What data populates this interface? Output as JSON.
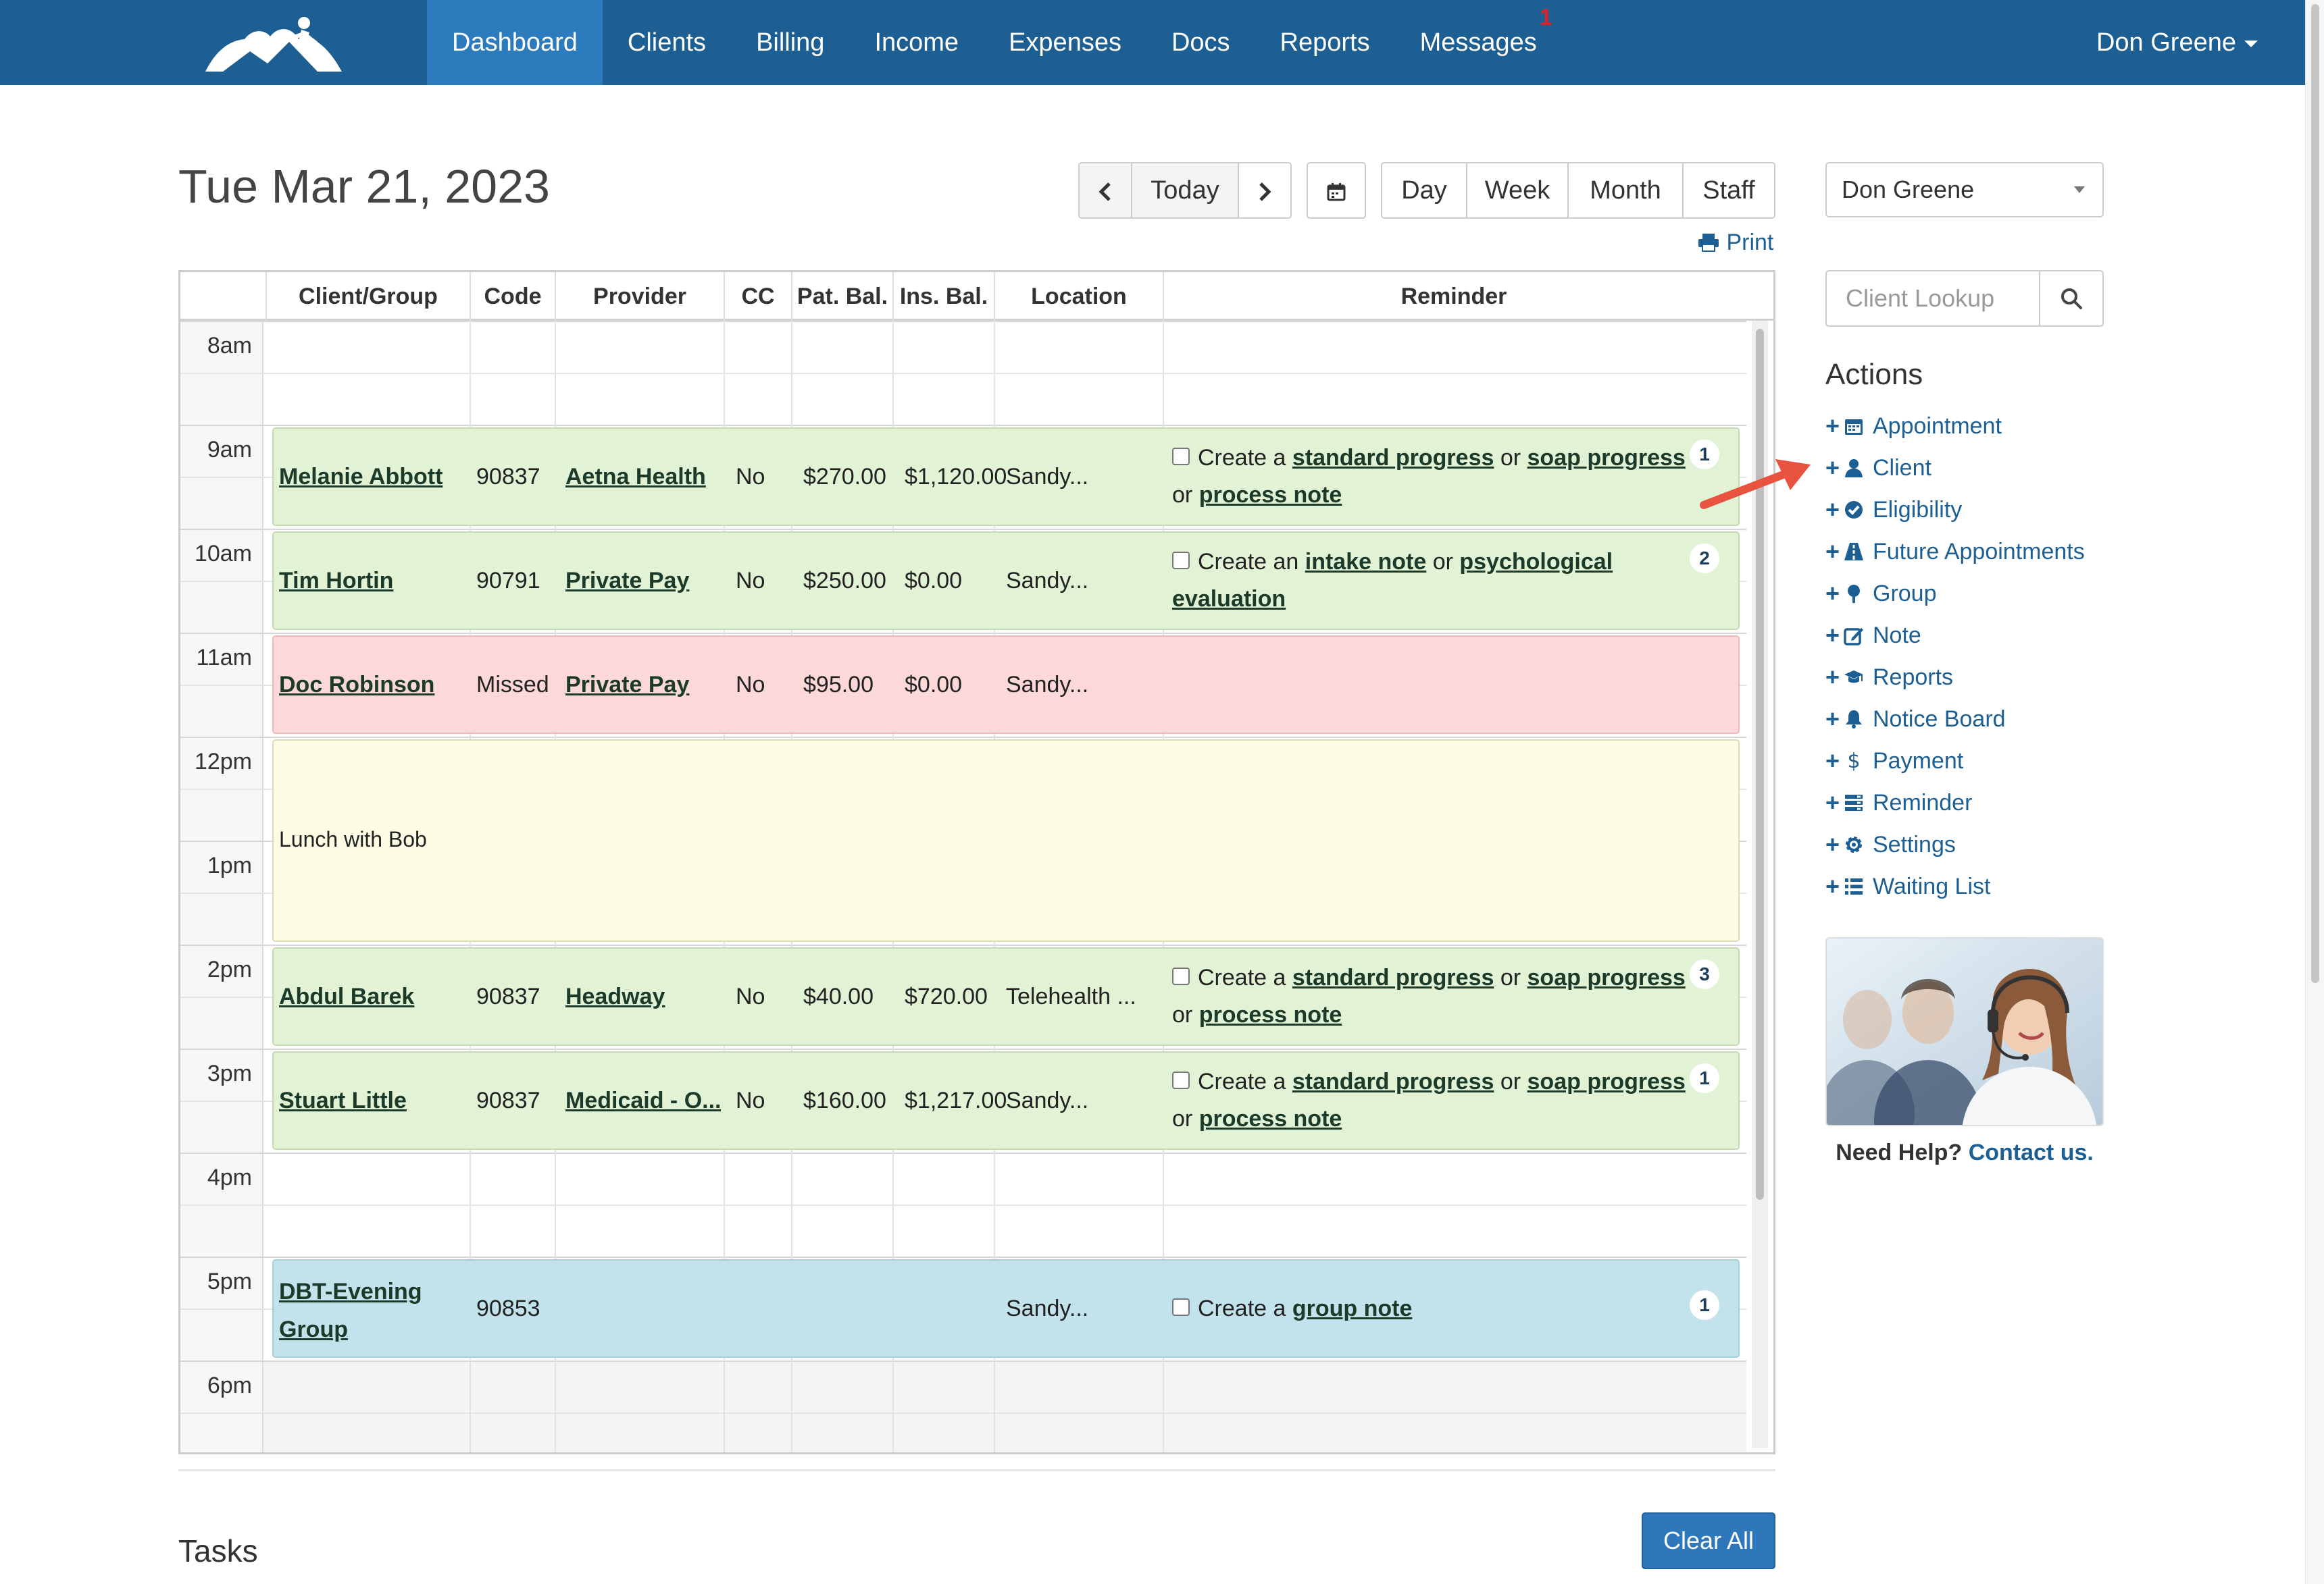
{
  "nav": {
    "items": [
      "Dashboard",
      "Clients",
      "Billing",
      "Income",
      "Expenses",
      "Docs",
      "Reports",
      "Messages"
    ],
    "messages_badge": "1",
    "user": "Don Greene"
  },
  "header": {
    "date": "Tue Mar 21, 2023",
    "today": "Today",
    "views": [
      "Day",
      "Week",
      "Month",
      "Staff"
    ],
    "print": "Print"
  },
  "table": {
    "columns": [
      "Client/Group",
      "Code",
      "Provider",
      "CC",
      "Pat. Bal.",
      "Ins. Bal.",
      "Location",
      "Reminder"
    ],
    "times": [
      "8am",
      "9am",
      "10am",
      "11am",
      "12pm",
      "1pm",
      "2pm",
      "3pm",
      "4pm",
      "5pm",
      "6pm"
    ],
    "appointments": [
      {
        "client": "Melanie Abbott",
        "code": "90837",
        "provider": "Aetna Health",
        "cc": "No",
        "pat": "$270.00",
        "ins": "$1,120.00",
        "location": "Sandy...",
        "r1": "Create a ",
        "l1": "standard progress",
        "r2": " or ",
        "l2": "soap progress",
        "r3": " or ",
        "l3": "process note",
        "badge": "1"
      },
      {
        "client": "Tim Hortin",
        "code": "90791",
        "provider": "Private Pay",
        "cc": "No",
        "pat": "$250.00",
        "ins": "$0.00",
        "location": "Sandy...",
        "r1": "Create an ",
        "l1": "intake note",
        "r2": " or ",
        "l2": "psychological evaluation",
        "badge": "2"
      },
      {
        "client": "Doc Robinson",
        "code": "Missed",
        "provider": "Private Pay",
        "cc": "No",
        "pat": "$95.00",
        "ins": "$0.00",
        "location": "Sandy..."
      },
      {
        "client": "Abdul Barek",
        "code": "90837",
        "provider": "Headway",
        "cc": "No",
        "pat": "$40.00",
        "ins": "$720.00",
        "location": "Telehealth ...",
        "r1": "Create a ",
        "l1": "standard progress",
        "r2": " or ",
        "l2": "soap progress",
        "r3": " or ",
        "l3": "process note",
        "badge": "3"
      },
      {
        "client": "Stuart Little",
        "code": "90837",
        "provider": "Medicaid - O...",
        "cc": "No",
        "pat": "$160.00",
        "ins": "$1,217.00",
        "location": "Sandy...",
        "r1": "Create a ",
        "l1": "standard progress",
        "r2": " or ",
        "l2": "soap progress",
        "r3": " or ",
        "l3": "process note",
        "badge": "1"
      },
      {
        "client": "DBT-Evening Group",
        "code": "90853",
        "location": "Sandy...",
        "r1": "Create a ",
        "l1": "group note",
        "badge": "1"
      }
    ],
    "lunch": "Lunch with Bob"
  },
  "tasks": {
    "title": "Tasks",
    "clear": "Clear All"
  },
  "sidebar": {
    "staff": "Don Greene",
    "lookup_placeholder": "Client Lookup",
    "actions_title": "Actions",
    "actions": [
      "Appointment",
      "Client",
      "Eligibility",
      "Future Appointments",
      "Group",
      "Note",
      "Reports",
      "Notice Board",
      "Payment",
      "Reminder",
      "Settings",
      "Waiting List"
    ],
    "help_q": "Need Help?",
    "help_link": "Contact us."
  },
  "colors": {
    "nav": "#1d5f93",
    "active": "#2c7bbd",
    "green": "#e2f2d5",
    "red": "#fdd8d8",
    "yellow": "#fdfde6",
    "blue": "#c2e2ec"
  }
}
